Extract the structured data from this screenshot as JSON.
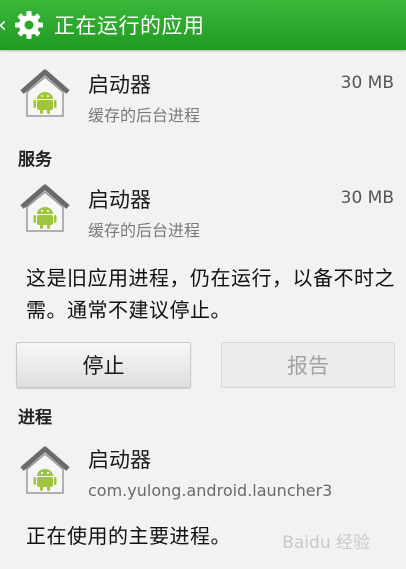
{
  "actionbar": {
    "title": "正在运行的应用",
    "back_icon": "chevron-left-icon",
    "settings_icon": "gear-icon"
  },
  "cached": {
    "name": "启动器",
    "subtitle": "缓存的后台进程",
    "size": "30 MB"
  },
  "services": {
    "header": "服务",
    "item": {
      "name": "启动器",
      "subtitle": "缓存的后台进程",
      "size": "30 MB"
    },
    "description": "这是旧应用进程，仍在运行，以备不时之需。通常不建议停止。",
    "stop_label": "停止",
    "report_label": "报告"
  },
  "processes": {
    "header": "进程",
    "item": {
      "name": "启动器",
      "subtitle": "com.yulong.android.launcher3"
    },
    "description": "正在使用的主要进程。"
  },
  "watermark": "Baidu 经验",
  "colors": {
    "actionbar": "#2aa82a",
    "android_green": "#9ec63b"
  }
}
